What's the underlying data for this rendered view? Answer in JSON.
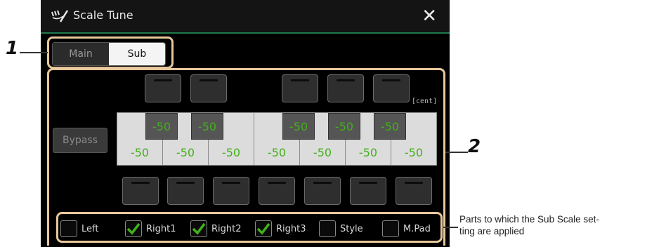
{
  "window": {
    "title": "Scale Tune",
    "close_symbol": "✕",
    "accent": "#1f7a4a"
  },
  "tabs": [
    {
      "label": "Main",
      "selected": false
    },
    {
      "label": "Sub",
      "selected": true
    }
  ],
  "callouts": {
    "one": "1",
    "two": "2"
  },
  "unit_label": "[cent]",
  "bypass_label": "Bypass",
  "keyboard": {
    "white_keys": [
      "-50",
      "-50",
      "-50",
      "-50",
      "-50",
      "-50",
      "-50"
    ],
    "black_keys": [
      "-50",
      "-50",
      "-50",
      "-50",
      "-50"
    ],
    "value_color": "#43b01a"
  },
  "parts": [
    {
      "label": "Left",
      "checked": false
    },
    {
      "label": "Right1",
      "checked": true
    },
    {
      "label": "Right2",
      "checked": true
    },
    {
      "label": "Right3",
      "checked": true
    },
    {
      "label": "Style",
      "checked": false
    },
    {
      "label": "M.Pad",
      "checked": false
    }
  ],
  "annotation": "Parts to which the Sub Scale set-\nting are applied"
}
